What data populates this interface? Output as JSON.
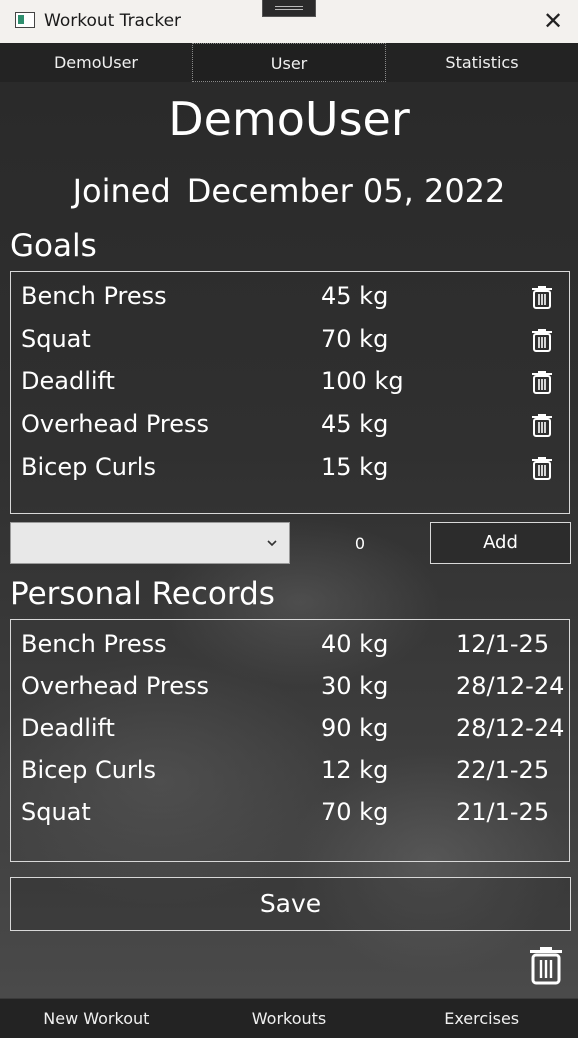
{
  "window": {
    "title": "Workout Tracker"
  },
  "tabs": [
    {
      "label": "DemoUser"
    },
    {
      "label": "User",
      "active": true
    },
    {
      "label": "Statistics"
    }
  ],
  "user": {
    "name": "DemoUser",
    "joined_label": "Joined",
    "joined_date": "December 05, 2022"
  },
  "goals": {
    "title": "Goals",
    "items": [
      {
        "exercise": "Bench Press",
        "weight": "45 kg"
      },
      {
        "exercise": "Squat",
        "weight": "70 kg"
      },
      {
        "exercise": "Deadlift",
        "weight": "100 kg"
      },
      {
        "exercise": "Overhead Press",
        "weight": "45 kg"
      },
      {
        "exercise": "Bicep Curls",
        "weight": "15 kg"
      }
    ]
  },
  "add_goal": {
    "selected_exercise": "",
    "amount": "0",
    "add_label": "Add"
  },
  "records": {
    "title": "Personal Records",
    "items": [
      {
        "exercise": "Bench Press",
        "weight": "40 kg",
        "date": "12/1-25"
      },
      {
        "exercise": "Overhead Press",
        "weight": "30 kg",
        "date": "28/12-24"
      },
      {
        "exercise": "Deadlift",
        "weight": "90 kg",
        "date": "28/12-24"
      },
      {
        "exercise": "Bicep Curls",
        "weight": "12 kg",
        "date": "22/1-25"
      },
      {
        "exercise": "Squat",
        "weight": "70 kg",
        "date": "21/1-25"
      }
    ]
  },
  "save_label": "Save",
  "bottom_nav": [
    {
      "label": "New Workout"
    },
    {
      "label": "Workouts"
    },
    {
      "label": "Exercises"
    }
  ],
  "colors": {
    "titlebar": "#f3f1ee",
    "tabbar": "#232323",
    "border": "#d8d8d8",
    "text": "#ffffff"
  }
}
